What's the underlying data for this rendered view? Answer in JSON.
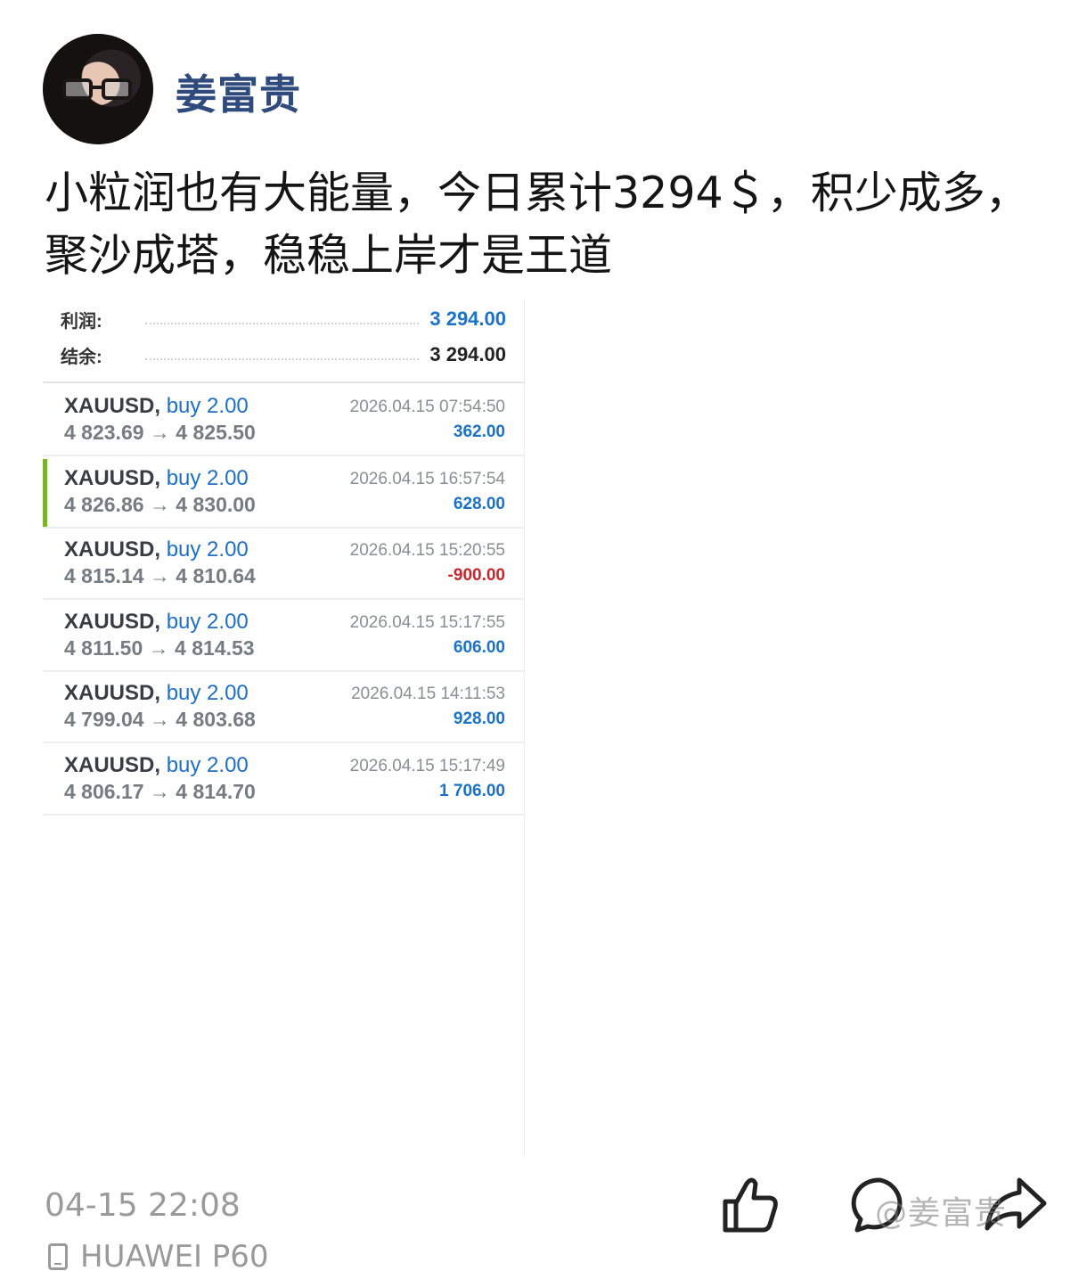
{
  "header": {
    "username": "姜富贵",
    "avatar_icon": "avatar-portrait"
  },
  "post": {
    "text": "小粒润也有大能量，今日累计3294＄，积少成多，聚沙成塔，稳稳上岸才是王道"
  },
  "trading_summary": {
    "profit_label": "利润:",
    "profit_value": "3 294.00",
    "balance_label": "结余:",
    "balance_value": "3 294.00"
  },
  "trades": [
    {
      "symbol": "XAUUSD,",
      "side": "buy 2.00",
      "prices": "4 823.69 → 4 825.50",
      "time": "2026.04.15 07:54:50",
      "profit": "362.00",
      "negative": false,
      "active": false
    },
    {
      "symbol": "XAUUSD,",
      "side": "buy 2.00",
      "prices": "4 826.86 → 4 830.00",
      "time": "2026.04.15 16:57:54",
      "profit": "628.00",
      "negative": false,
      "active": true
    },
    {
      "symbol": "XAUUSD,",
      "side": "buy 2.00",
      "prices": "4 815.14 → 4 810.64",
      "time": "2026.04.15 15:20:55",
      "profit": "-900.00",
      "negative": true,
      "active": false
    },
    {
      "symbol": "XAUUSD,",
      "side": "buy 2.00",
      "prices": "4 811.50 → 4 814.53",
      "time": "2026.04.15 15:17:55",
      "profit": "606.00",
      "negative": false,
      "active": false
    },
    {
      "symbol": "XAUUSD,",
      "side": "buy 2.00",
      "prices": "4 799.04 → 4 803.68",
      "time": "2026.04.15 14:11:53",
      "profit": "928.00",
      "negative": false,
      "active": false
    },
    {
      "symbol": "XAUUSD,",
      "side": "buy 2.00",
      "prices": "4 806.17 → 4 814.70",
      "time": "2026.04.15 15:17:49",
      "profit": "1 706.00",
      "negative": false,
      "active": false
    }
  ],
  "footer": {
    "timestamp": "04-15 22:08",
    "device": "HUAWEI P60",
    "watermark": "@姜富贵",
    "icons": [
      "like-icon",
      "comment-icon",
      "share-icon",
      "phone-icon"
    ]
  },
  "colors": {
    "username": "#2f4a7c",
    "profit_blue": "#1a73c6",
    "loss_red": "#c9262b",
    "active_bar": "#7ab42c"
  }
}
